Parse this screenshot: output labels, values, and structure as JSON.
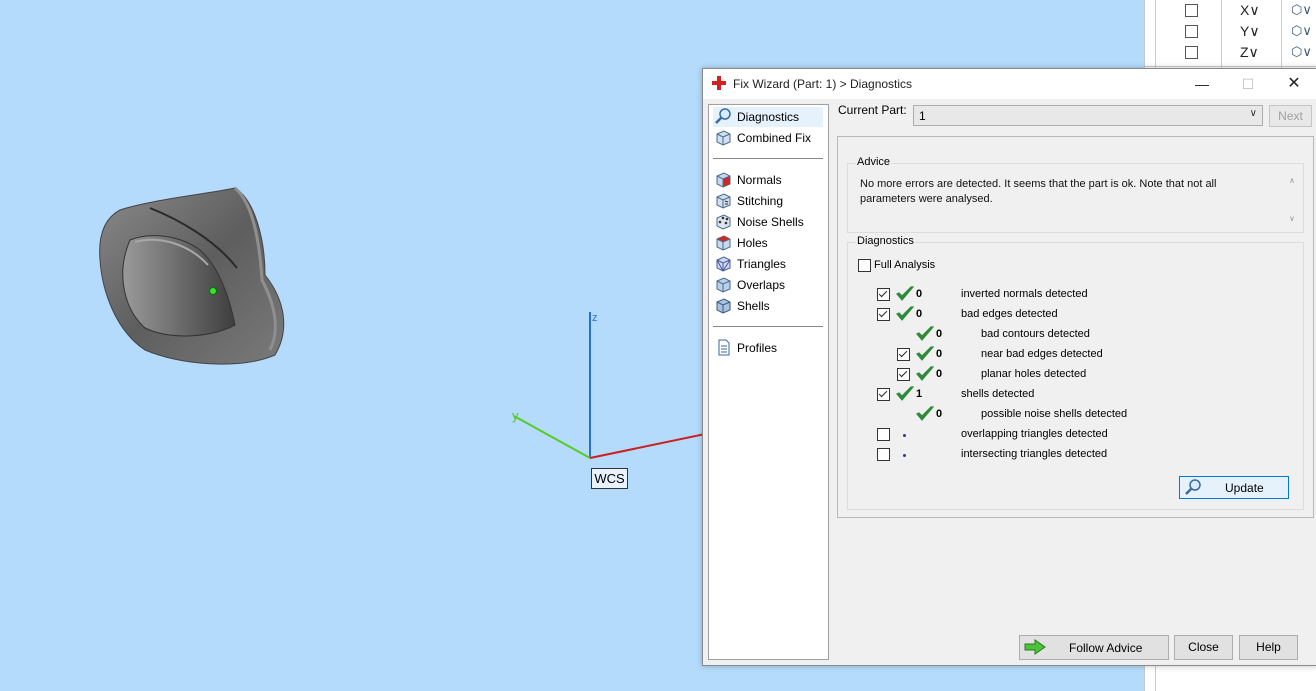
{
  "side_panel": {
    "rows": [
      {
        "axis": "X∨"
      },
      {
        "axis": "Y∨"
      },
      {
        "axis": "Z∨"
      }
    ]
  },
  "viewport": {
    "axis_z": "z",
    "axis_y": "y",
    "wcs_label": "WCS"
  },
  "dialog": {
    "title": "Fix Wizard (Part: 1) > Diagnostics",
    "nav": {
      "group1": [
        {
          "label": "Diagnostics",
          "icon": "magnifier-icon",
          "selected": true
        },
        {
          "label": "Combined Fix",
          "icon": "cube-icon"
        }
      ],
      "group2": [
        {
          "label": "Normals",
          "icon": "normals-cube-icon"
        },
        {
          "label": "Stitching",
          "icon": "stitching-cube-icon"
        },
        {
          "label": "Noise Shells",
          "icon": "noise-shells-icon"
        },
        {
          "label": "Holes",
          "icon": "holes-cube-icon"
        },
        {
          "label": "Triangles",
          "icon": "triangles-cube-icon"
        },
        {
          "label": "Overlaps",
          "icon": "overlaps-cube-icon"
        },
        {
          "label": "Shells",
          "icon": "shells-cube-icon"
        }
      ],
      "group3": [
        {
          "label": "Profiles",
          "icon": "document-icon"
        }
      ]
    },
    "current_part_label": "Current Part:",
    "current_part_value": "1",
    "next_label": "Next",
    "advice": {
      "title": "Advice",
      "text": "No more errors are detected. It seems that the part is ok. Note that not all parameters were analysed."
    },
    "diagnostics": {
      "title": "Diagnostics",
      "full_analysis_label": "Full Analysis",
      "full_analysis_checked": false,
      "rows": [
        {
          "checked": true,
          "status": "ok",
          "count": "0",
          "text": "inverted normals detected",
          "level": 0,
          "has_checkbox": true
        },
        {
          "checked": true,
          "status": "ok",
          "count": "0",
          "text": "bad edges detected",
          "level": 0,
          "has_checkbox": true
        },
        {
          "checked": false,
          "status": "ok",
          "count": "0",
          "text": "bad contours detected",
          "level": 1,
          "has_checkbox": false
        },
        {
          "checked": true,
          "status": "ok",
          "count": "0",
          "text": "near bad edges detected",
          "level": 1,
          "has_checkbox": true
        },
        {
          "checked": true,
          "status": "ok",
          "count": "0",
          "text": "planar holes detected",
          "level": 1,
          "has_checkbox": true
        },
        {
          "checked": true,
          "status": "ok",
          "count": "1",
          "text": "shells detected",
          "level": 0,
          "has_checkbox": true
        },
        {
          "checked": false,
          "status": "ok",
          "count": "0",
          "text": "possible noise shells detected",
          "level": 1,
          "has_checkbox": false
        },
        {
          "checked": false,
          "status": "pending",
          "count": "",
          "text": "overlapping triangles detected",
          "level": 0,
          "has_checkbox": true
        },
        {
          "checked": false,
          "status": "pending",
          "count": "",
          "text": "intersecting triangles detected",
          "level": 0,
          "has_checkbox": true
        }
      ]
    },
    "update_label": "Update",
    "follow_advice_label": "Follow Advice",
    "close_label": "Close",
    "help_label": "Help"
  },
  "colors": {
    "viewport_bg": "#b5dbfc",
    "axis_x": "#cc1f1f",
    "axis_y": "#55cc22",
    "axis_z": "#2a6fd6",
    "check_green": "#2e8b3a",
    "model_gray": "#6b6b6b"
  }
}
